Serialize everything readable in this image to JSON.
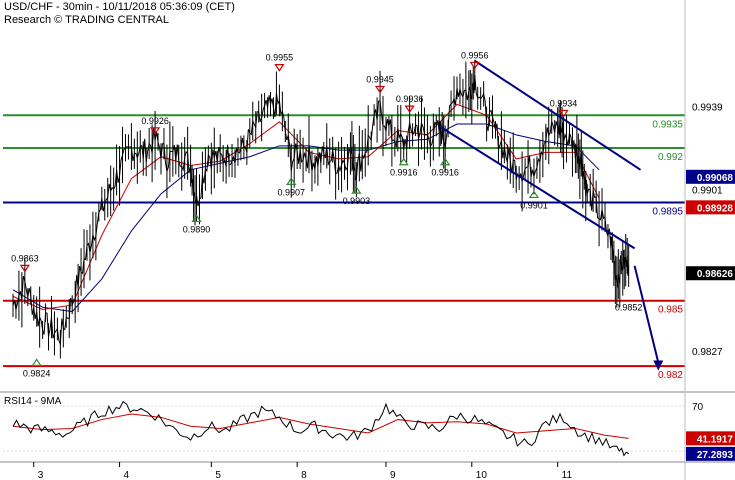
{
  "header": {
    "title": "USD/CHF - 30min - 10/11/2018 05:36:09 (CET)",
    "subtitle": "Research © TRADING CENTRAL"
  },
  "colors": {
    "price": "#000000",
    "ma_fast": "#cc0000",
    "ma_slow": "#000080",
    "resistance": "#2e8b2e",
    "pivot": "#00008b",
    "support": "#cc0000",
    "channel": "#000080",
    "up_marker": "#2e8b2e",
    "down_marker": "#cc0000",
    "rsi": "#000000",
    "rsi_ma": "#cc0000"
  },
  "chart_data": [
    {
      "type": "line",
      "name": "price-panel",
      "x": [
        "3",
        "4",
        "5",
        "8",
        "9",
        "10",
        "11"
      ],
      "ylim": [
        0.981,
        0.9975
      ],
      "right_axis_ticks": [
        "0.9939",
        "0.9901",
        "0.9827"
      ],
      "levels": [
        {
          "label": "0.9935",
          "value": 0.9935,
          "kind": "resistance"
        },
        {
          "label": "0.992",
          "value": 0.992,
          "kind": "resistance"
        },
        {
          "label": "0.9895",
          "value": 0.9895,
          "kind": "pivot"
        },
        {
          "label": "0.985",
          "value": 0.985,
          "kind": "support"
        },
        {
          "label": "0.982",
          "value": 0.982,
          "kind": "support"
        }
      ],
      "value_tags": [
        {
          "label": "0.99068",
          "value": 0.99068,
          "color": "#00008b"
        },
        {
          "label": "0.98928",
          "value": 0.98928,
          "color": "#cc0000"
        },
        {
          "label": "0.98626",
          "value": 0.98626,
          "color": "#000000"
        }
      ],
      "annotations": [
        {
          "label": "0.9863",
          "t": 0.02,
          "value": 0.9863,
          "dir": "down"
        },
        {
          "label": "0.9824",
          "t": 0.04,
          "value": 0.9824,
          "dir": "up"
        },
        {
          "label": "0.9926",
          "t": 0.24,
          "value": 0.9926,
          "dir": "down"
        },
        {
          "label": "0.9890",
          "t": 0.31,
          "value": 0.989,
          "dir": "up"
        },
        {
          "label": "0.9955",
          "t": 0.45,
          "value": 0.9955,
          "dir": "down"
        },
        {
          "label": "0.9907",
          "t": 0.47,
          "value": 0.9907,
          "dir": "up"
        },
        {
          "label": "0.9903",
          "t": 0.58,
          "value": 0.9903,
          "dir": "up"
        },
        {
          "label": "0.9945",
          "t": 0.62,
          "value": 0.9945,
          "dir": "down"
        },
        {
          "label": "0.9936",
          "t": 0.67,
          "value": 0.9936,
          "dir": "down"
        },
        {
          "label": "0.9916",
          "t": 0.66,
          "value": 0.9916,
          "dir": "up"
        },
        {
          "label": "0.9916",
          "t": 0.73,
          "value": 0.9916,
          "dir": "up"
        },
        {
          "label": "0.9956",
          "t": 0.78,
          "value": 0.9956,
          "dir": "down"
        },
        {
          "label": "0.9901",
          "t": 0.88,
          "value": 0.9901,
          "dir": "up"
        },
        {
          "label": "0.9934",
          "t": 0.93,
          "value": 0.9934,
          "dir": "down"
        },
        {
          "label": "0.9852",
          "t": 1.04,
          "value": 0.9852,
          "dir": "none"
        }
      ],
      "series": [
        {
          "role": "price",
          "t": [
            0.0,
            0.02,
            0.04,
            0.06,
            0.08,
            0.1,
            0.12,
            0.14,
            0.16,
            0.18,
            0.2,
            0.22,
            0.24,
            0.26,
            0.28,
            0.3,
            0.31,
            0.33,
            0.35,
            0.37,
            0.39,
            0.41,
            0.43,
            0.45,
            0.47,
            0.49,
            0.51,
            0.53,
            0.55,
            0.57,
            0.58,
            0.6,
            0.62,
            0.64,
            0.66,
            0.68,
            0.7,
            0.72,
            0.73,
            0.75,
            0.77,
            0.78,
            0.8,
            0.82,
            0.84,
            0.86,
            0.88,
            0.9,
            0.92,
            0.93,
            0.95,
            0.96,
            0.97,
            0.99,
            1.01,
            1.02,
            1.03,
            1.04
          ],
          "values": [
            0.9848,
            0.9858,
            0.9843,
            0.9838,
            0.9834,
            0.985,
            0.9868,
            0.9885,
            0.9898,
            0.991,
            0.992,
            0.9918,
            0.9924,
            0.9915,
            0.9918,
            0.9912,
            0.9895,
            0.9917,
            0.9915,
            0.9918,
            0.992,
            0.993,
            0.9938,
            0.994,
            0.9915,
            0.9918,
            0.9914,
            0.9917,
            0.9912,
            0.9918,
            0.991,
            0.9923,
            0.9938,
            0.9926,
            0.9922,
            0.993,
            0.9925,
            0.9928,
            0.9925,
            0.9948,
            0.9945,
            0.9952,
            0.9935,
            0.9925,
            0.9913,
            0.991,
            0.9912,
            0.9925,
            0.993,
            0.9927,
            0.992,
            0.9915,
            0.99,
            0.989,
            0.9878,
            0.986,
            0.9868,
            0.9866
          ]
        },
        {
          "role": "ma_fast",
          "t": [
            0.0,
            0.05,
            0.1,
            0.15,
            0.2,
            0.25,
            0.3,
            0.35,
            0.4,
            0.45,
            0.5,
            0.55,
            0.6,
            0.65,
            0.7,
            0.75,
            0.8,
            0.85,
            0.9,
            0.95,
            0.99
          ],
          "values": [
            0.9852,
            0.9846,
            0.9848,
            0.988,
            0.9906,
            0.9916,
            0.9912,
            0.9914,
            0.9922,
            0.9932,
            0.9918,
            0.9915,
            0.9916,
            0.9928,
            0.9926,
            0.994,
            0.9935,
            0.9915,
            0.9918,
            0.9918,
            0.9897
          ]
        },
        {
          "role": "ma_slow",
          "t": [
            0.0,
            0.05,
            0.1,
            0.15,
            0.2,
            0.25,
            0.3,
            0.35,
            0.4,
            0.45,
            0.5,
            0.55,
            0.6,
            0.65,
            0.7,
            0.75,
            0.8,
            0.85,
            0.9,
            0.95,
            0.99
          ],
          "values": [
            0.9855,
            0.9847,
            0.9845,
            0.986,
            0.9882,
            0.9899,
            0.991,
            0.9913,
            0.9916,
            0.9921,
            0.9921,
            0.9919,
            0.9919,
            0.9923,
            0.9924,
            0.9931,
            0.9931,
            0.9926,
            0.9923,
            0.9921,
            0.991
          ]
        }
      ],
      "channel": {
        "upper": [
          {
            "t": 0.78,
            "value": 0.996
          },
          {
            "t": 1.06,
            "value": 0.991
          }
        ],
        "lower": [
          {
            "t": 0.72,
            "value": 0.993
          },
          {
            "t": 1.05,
            "value": 0.9874
          }
        ]
      },
      "projection": [
        {
          "t": 1.05,
          "value": 0.9866
        },
        {
          "t": 1.09,
          "value": 0.9818
        }
      ]
    },
    {
      "type": "line",
      "name": "rsi-panel",
      "label": "RSI14 - 9MA",
      "ylim": [
        20,
        80
      ],
      "right_axis_ticks": [
        "70",
        "30"
      ],
      "value_tags": [
        {
          "label": "41.1917",
          "value": 41.19,
          "color": "#cc0000"
        },
        {
          "label": "27.2893",
          "value": 27.29,
          "color": "#00008b"
        }
      ],
      "series": [
        {
          "role": "rsi",
          "t": [
            0.0,
            0.03,
            0.06,
            0.09,
            0.12,
            0.15,
            0.18,
            0.21,
            0.24,
            0.27,
            0.3,
            0.33,
            0.36,
            0.39,
            0.42,
            0.45,
            0.48,
            0.51,
            0.54,
            0.57,
            0.6,
            0.63,
            0.66,
            0.69,
            0.72,
            0.75,
            0.78,
            0.81,
            0.84,
            0.87,
            0.9,
            0.93,
            0.96,
            0.99,
            1.02,
            1.04
          ],
          "values": [
            55,
            50,
            48,
            45,
            55,
            65,
            70,
            68,
            62,
            50,
            42,
            52,
            48,
            58,
            66,
            60,
            48,
            52,
            45,
            42,
            48,
            70,
            55,
            52,
            50,
            62,
            58,
            50,
            42,
            35,
            55,
            60,
            45,
            40,
            30,
            27.3
          ]
        },
        {
          "role": "rsi_ma",
          "t": [
            0.0,
            0.05,
            0.1,
            0.15,
            0.2,
            0.25,
            0.3,
            0.35,
            0.4,
            0.45,
            0.5,
            0.55,
            0.6,
            0.65,
            0.7,
            0.75,
            0.8,
            0.85,
            0.9,
            0.95,
            1.0,
            1.04
          ],
          "values": [
            52,
            49,
            50,
            58,
            63,
            60,
            52,
            50,
            55,
            60,
            54,
            50,
            46,
            58,
            55,
            56,
            54,
            46,
            48,
            50,
            44,
            41.2
          ]
        }
      ]
    }
  ]
}
